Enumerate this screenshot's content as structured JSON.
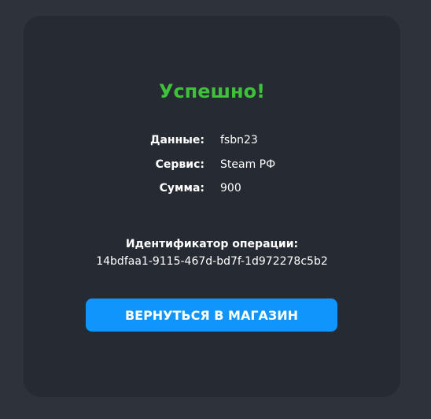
{
  "status": {
    "title": "Успешно!"
  },
  "details": [
    {
      "label": "Данные:",
      "value": "fsbn23"
    },
    {
      "label": "Сервис:",
      "value": "Steam РФ"
    },
    {
      "label": "Сумма:",
      "value": "900"
    }
  ],
  "operation": {
    "label": "Идентификатор операции:",
    "id": "14bdfaa1-9115-467d-bd7f-1d972278c5b2"
  },
  "actions": {
    "back_label": "ВЕРНУТЬСЯ В МАГАЗИН"
  },
  "colors": {
    "page_bg": "#2e333b",
    "card_bg": "#262a32",
    "success": "#3fc13c",
    "accent": "#0f95fb",
    "text": "#ffffff"
  }
}
